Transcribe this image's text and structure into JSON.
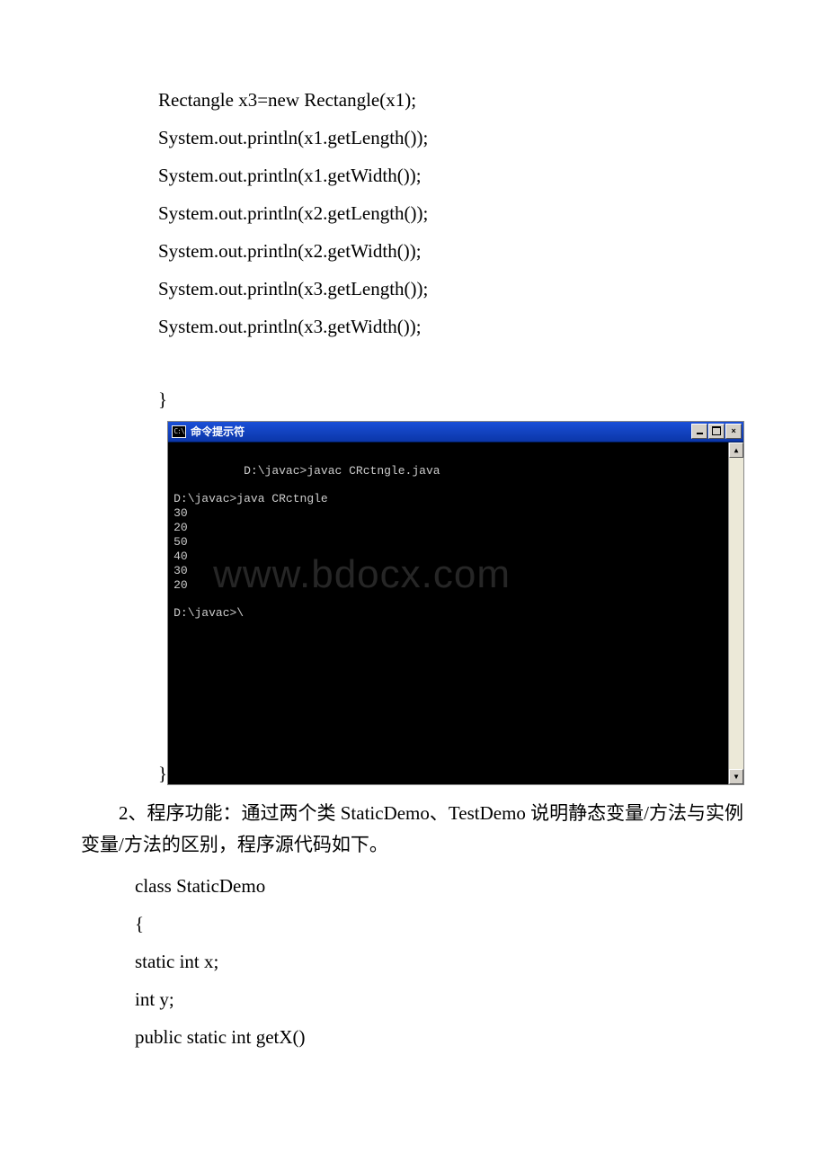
{
  "code_top": {
    "l1": "Rectangle x3=new Rectangle(x1);",
    "l2": "System.out.println(x1.getLength());",
    "l3": "System.out.println(x1.getWidth());",
    "l4": "System.out.println(x2.getLength());",
    "l5": "System.out.println(x2.getWidth());",
    "l6": "System.out.println(x3.getLength());",
    "l7": "System.out.println(x3.getWidth());",
    "brace1": "}",
    "brace2": "}"
  },
  "terminal": {
    "icon": "C:\\",
    "title": "命令提示符",
    "out": "D:\\javac>javac CRctngle.java\n\nD:\\javac>java CRctngle\n30\n20\n50\n40\n30\n20\n\nD:\\javac>\\",
    "watermark": "www.bdocx.com",
    "btn_min": "_",
    "btn_max": "□",
    "btn_close": "×",
    "arrow_up": "▲",
    "arrow_down": "▼"
  },
  "para": "2、程序功能：通过两个类 StaticDemo、TestDemo 说明静态变量/方法与实例变量/方法的区别，程序源代码如下。",
  "code_bottom": {
    "l1": "class StaticDemo",
    "l2": "{",
    "l3": " static int x;",
    "l4": " int y;",
    "l5": " public static int getX()"
  }
}
